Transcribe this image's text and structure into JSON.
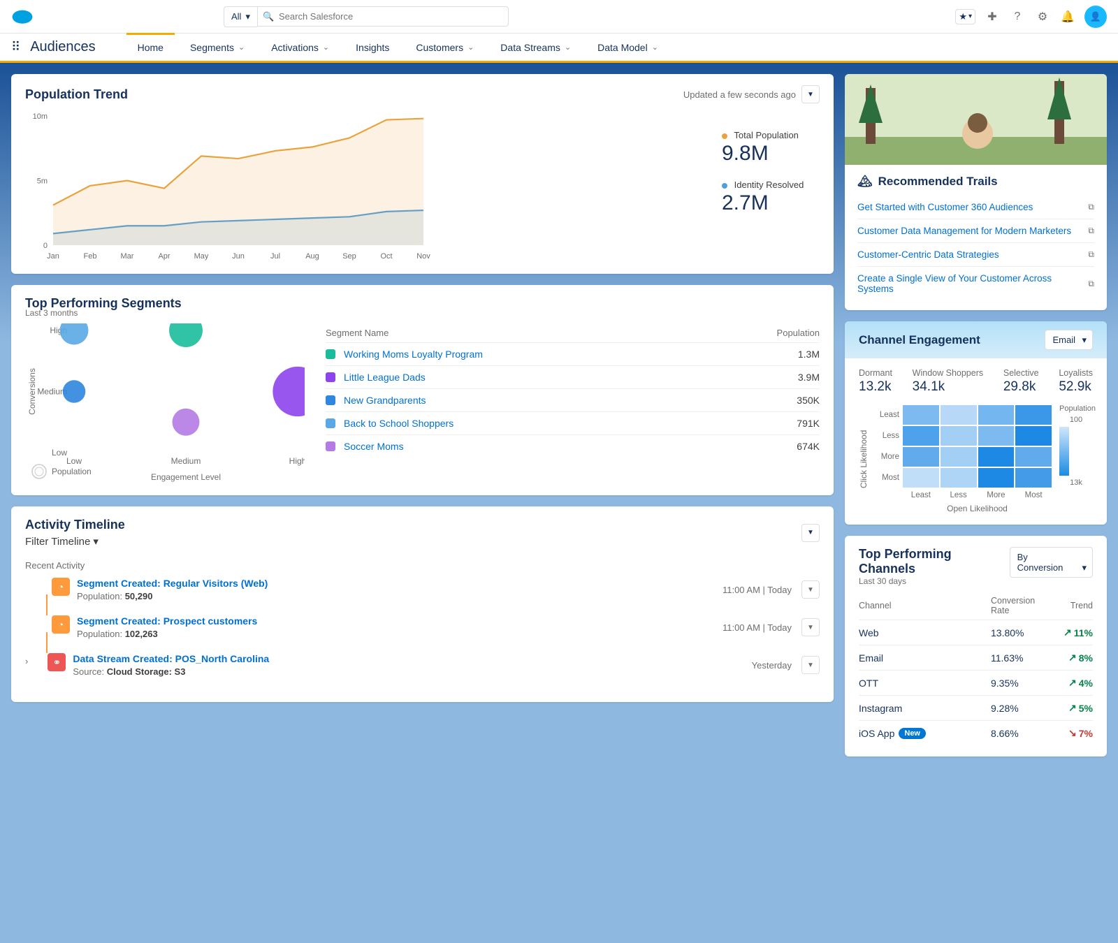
{
  "topbar": {
    "search_scope": "All",
    "search_placeholder": "Search Salesforce"
  },
  "nav": {
    "app_name": "Audiences",
    "tabs": [
      "Home",
      "Segments",
      "Activations",
      "Insights",
      "Customers",
      "Data Streams",
      "Data Model"
    ],
    "active": "Home"
  },
  "population_trend": {
    "title": "Population Trend",
    "updated": "Updated a few seconds ago",
    "legend": [
      {
        "label": "Total Population",
        "value": "9.8M",
        "color": "#e8a33d"
      },
      {
        "label": "Identity Resolved",
        "value": "2.7M",
        "color": "#4f9fdd"
      }
    ]
  },
  "top_segments": {
    "title": "Top Performing Segments",
    "subtitle": "Last 3 months",
    "columns": {
      "name": "Segment Name",
      "pop": "Population"
    },
    "xlabel": "Engagement Level",
    "ylabel": "Conversions",
    "pop_legend": "Population",
    "axis_ticks": {
      "y": [
        "High",
        "Medium",
        "Low"
      ],
      "x": [
        "Low",
        "Medium",
        "High"
      ]
    },
    "rows": [
      {
        "name": "Working Moms Loyalty Program",
        "pop": "1.3M",
        "color": "#1bbc9b"
      },
      {
        "name": "Little League Dads",
        "pop": "3.9M",
        "color": "#8e44ec"
      },
      {
        "name": "New Grandparents",
        "pop": "350K",
        "color": "#2e86de"
      },
      {
        "name": "Back to School Shoppers",
        "pop": "791K",
        "color": "#5aa9e6"
      },
      {
        "name": "Soccer Moms",
        "pop": "674K",
        "color": "#b57be4"
      }
    ]
  },
  "timeline": {
    "title": "Activity Timeline",
    "filter_label": "Filter Timeline",
    "recent_label": "Recent Activity",
    "items": [
      {
        "icon": "orange",
        "title": "Segment Created: Regular Visitors (Web)",
        "meta_label": "Population:",
        "meta_value": "50,290",
        "time": "11:00 AM | Today"
      },
      {
        "icon": "orange",
        "title": "Segment Created: Prospect customers",
        "meta_label": "Population:",
        "meta_value": "102,263",
        "time": "11:00 AM | Today"
      },
      {
        "icon": "red",
        "expand": true,
        "title": "Data Stream Created: POS_North Carolina",
        "meta_label": "Source:",
        "meta_value": "Cloud Storage: S3",
        "time": "Yesterday"
      }
    ]
  },
  "trails": {
    "title": "Recommended Trails",
    "links": [
      "Get Started with Customer 360 Audiences",
      "Customer Data Management for Modern Marketers",
      "Customer-Centric Data Strategies",
      "Create a Single View of Your Customer Across Systems"
    ]
  },
  "channel_engagement": {
    "title": "Channel Engagement",
    "selector": "Email",
    "stats": [
      {
        "label": "Dormant",
        "value": "13.2k"
      },
      {
        "label": "Window Shoppers",
        "value": "34.1k"
      },
      {
        "label": "Selective",
        "value": "29.8k"
      },
      {
        "label": "Loyalists",
        "value": "52.9k"
      }
    ],
    "ylabel": "Click Likelihood",
    "xlabel": "Open Likelihood",
    "row_labels": [
      "Least",
      "Less",
      "More",
      "Most"
    ],
    "col_labels": [
      "Least",
      "Less",
      "More",
      "Most"
    ],
    "legend": {
      "title": "Population",
      "max": "100",
      "min": "13k"
    }
  },
  "top_channels": {
    "title": "Top Performing Channels",
    "subtitle": "Last 30 days",
    "selector": "By Conversion",
    "columns": {
      "ch": "Channel",
      "cr": "Conversion Rate",
      "tr": "Trend"
    },
    "rows": [
      {
        "channel": "Web",
        "rate": "13.80%",
        "trend": "11%",
        "dir": "up"
      },
      {
        "channel": "Email",
        "rate": "11.63%",
        "trend": "8%",
        "dir": "up"
      },
      {
        "channel": "OTT",
        "rate": "9.35%",
        "trend": "4%",
        "dir": "up"
      },
      {
        "channel": "Instagram",
        "rate": "9.28%",
        "trend": "5%",
        "dir": "up"
      },
      {
        "channel": "iOS App",
        "badge": "New",
        "rate": "8.66%",
        "trend": "7%",
        "dir": "down"
      }
    ]
  },
  "chart_data": [
    {
      "type": "area",
      "title": "Population Trend",
      "categories": [
        "Jan",
        "Feb",
        "Mar",
        "Apr",
        "May",
        "Jun",
        "Jul",
        "Aug",
        "Sep",
        "Oct",
        "Nov"
      ],
      "series": [
        {
          "name": "Total Population",
          "values": [
            3.1,
            4.6,
            5.0,
            4.4,
            6.9,
            6.7,
            7.3,
            7.6,
            8.3,
            9.7,
            9.8
          ],
          "color": "#e8a33d"
        },
        {
          "name": "Identity Resolved",
          "values": [
            0.9,
            1.2,
            1.5,
            1.5,
            1.8,
            1.9,
            2.0,
            2.1,
            2.2,
            2.6,
            2.7
          ],
          "color": "#4f9fdd"
        }
      ],
      "ylabel": "",
      "ylim": [
        0,
        10
      ],
      "yunit": "m"
    },
    {
      "type": "scatter",
      "title": "Top Performing Segments",
      "xlabel": "Engagement Level",
      "ylabel": "Conversions",
      "x_order": [
        "Low",
        "Medium",
        "High"
      ],
      "y_order": [
        "Low",
        "Medium",
        "High"
      ],
      "points": [
        {
          "name": "Working Moms Loyalty Program",
          "x": "Medium",
          "y": "High",
          "size": 1.3,
          "color": "#1bbc9b"
        },
        {
          "name": "Little League Dads",
          "x": "High",
          "y": "Medium",
          "size": 3.9,
          "color": "#8e44ec"
        },
        {
          "name": "New Grandparents",
          "x": "Low",
          "y": "Medium",
          "size": 0.35,
          "color": "#2e86de"
        },
        {
          "name": "Back to School Shoppers",
          "x": "Low",
          "y": "High",
          "size": 0.79,
          "color": "#5aa9e6"
        },
        {
          "name": "Soccer Moms",
          "x": "Medium",
          "y": "Low-Medium",
          "size": 0.67,
          "color": "#b57be4"
        }
      ]
    },
    {
      "type": "heatmap",
      "title": "Channel Engagement",
      "xlabel": "Open Likelihood",
      "ylabel": "Click Likelihood",
      "x_categories": [
        "Least",
        "Less",
        "More",
        "Most"
      ],
      "y_categories": [
        "Least",
        "Less",
        "More",
        "Most"
      ],
      "values": [
        [
          0.5,
          0.2,
          0.55,
          0.85
        ],
        [
          0.75,
          0.3,
          0.5,
          1.0
        ],
        [
          0.65,
          0.3,
          1.0,
          0.65
        ],
        [
          0.15,
          0.25,
          1.0,
          0.8
        ]
      ],
      "legend": {
        "min": "13k",
        "max": "100",
        "label": "Population"
      }
    }
  ]
}
